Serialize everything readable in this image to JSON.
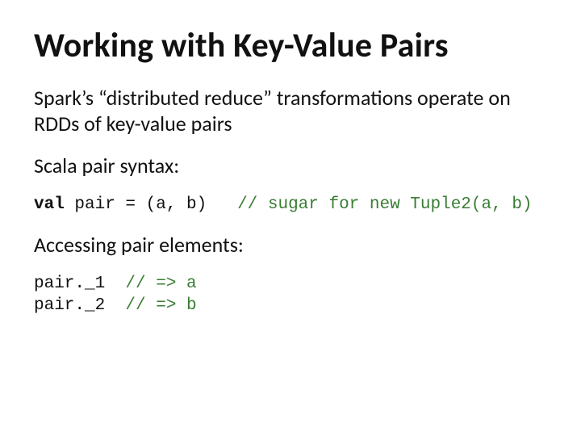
{
  "title": "Working with Key-Value Pairs",
  "intro": "Spark’s “distributed reduce” transformations operate on RDDs of key-value pairs",
  "syntax_heading": "Scala pair syntax:",
  "code1_kw": "val",
  "code1_rest": " pair = (a, b)   ",
  "code1_comment": "// sugar for new Tuple2(a, b)",
  "access_heading": "Accessing pair elements:",
  "code2_line1_text": "pair._1  ",
  "code2_line1_comment": "// => a",
  "code2_line2_text": "pair._2  ",
  "code2_line2_comment": "// => b"
}
